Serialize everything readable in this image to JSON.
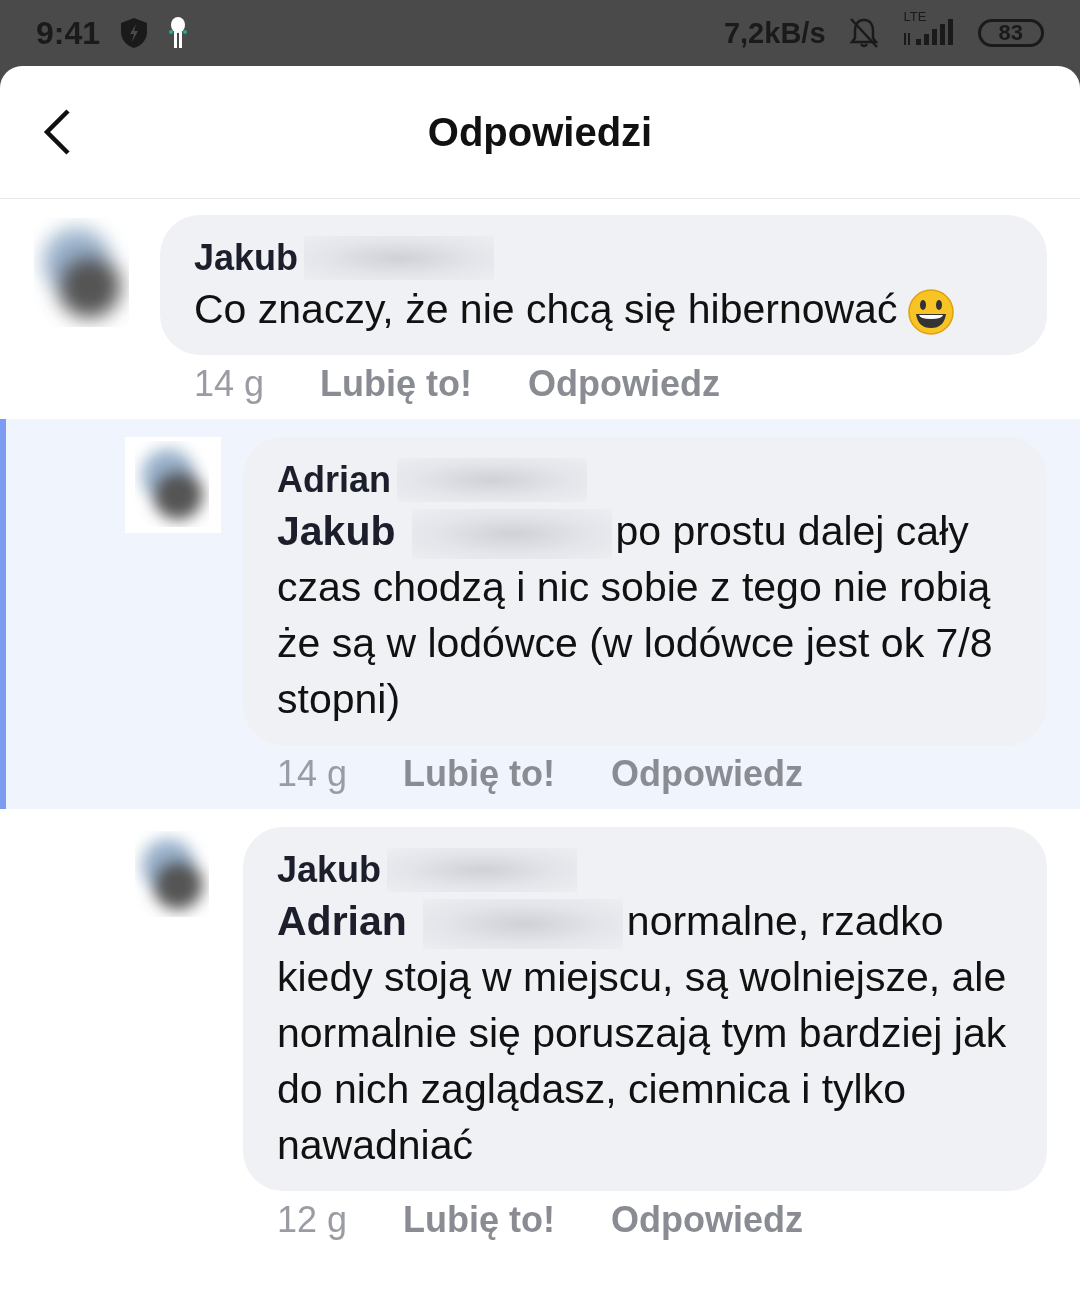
{
  "status_bar": {
    "time": "9:41",
    "speed": "7,2kB/s",
    "network": "LTE",
    "battery": "83"
  },
  "header": {
    "title": "Odpowiedzi"
  },
  "comments": [
    {
      "author": "Jakub",
      "text": "Co znaczy, że nie chcą się hibernować",
      "emoji": true,
      "highlighted": false,
      "time": "14 g",
      "like": "Lubię to!",
      "reply": "Odpowiedz",
      "children": [
        {
          "author": "Adrian",
          "mention": "Jakub",
          "text": "po prostu dalej cały czas chodzą i nic sobie z tego nie robią że są w lodówce (w lodówce jest ok 7/8 stopni)",
          "emoji": false,
          "highlighted": true,
          "time": "14 g",
          "like": "Lubię to!",
          "reply": "Odpowiedz"
        },
        {
          "author": "Jakub",
          "mention": "Adrian",
          "text": "normalne, rzadko kiedy stoją w miejscu, są wolniejsze, ale normalnie się poruszają tym bardziej jak do nich zaglądasz, ciemnica i tylko nawadniać",
          "emoji": false,
          "highlighted": false,
          "time": "12 g",
          "like": "Lubię to!",
          "reply": "Odpowiedz"
        }
      ]
    }
  ]
}
